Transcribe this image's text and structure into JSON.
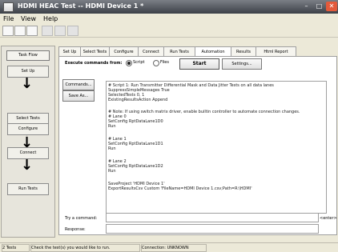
{
  "window": {
    "title": "HDMI HEAC Test -- HDMI Device 1 *",
    "minimize_glyph": "–",
    "maximize_glyph": "□",
    "close_glyph": "✕"
  },
  "menu": [
    "File",
    "View",
    "Help"
  ],
  "task_flow": {
    "title": "Task Flow",
    "steps": [
      "Set Up",
      "Select Tests",
      "Configure",
      "Connect",
      "Run Tests"
    ],
    "arrow_glyph": "↓"
  },
  "tabs": [
    "Set Up",
    "Select Tests",
    "Configure",
    "Connect",
    "Run Tests",
    "Automation",
    "Results",
    "Html Report"
  ],
  "automation": {
    "execute_label": "Execute commands from:",
    "script_option": "Script",
    "files_option": "Files",
    "start_button": "Start",
    "settings_button": "Settings...",
    "commands_button": "Commands...",
    "saveas_button": "Save As...",
    "script_lines": [
      "# Script 1: Run Transmitter Differential Mask and Data Jitter Tests on all data lanes",
      "SuppressSimpleMessages True",
      "SelectedTests 0, 1",
      "ExistingResultsAction Append",
      "",
      "# Note: If using switch matrix driver, enable builtin controller to automate connection changes.",
      "# Lane 0",
      "SetConfig RptDataLane1D0",
      "Run",
      "",
      "# Lane 1",
      "SetConfig RptDataLane1D1",
      "Run",
      "",
      "# Lane 2",
      "SetConfig RptDataLane1D2",
      "Run",
      "",
      "SaveProject 'HDMI Device 1'",
      "ExportResultsCsv Custom 'FileName=HDMI Device 1.csv;Path=R:\\HDMI'"
    ],
    "try_command_label": "Try a command:",
    "enter_hint": "<enter>",
    "response_label": "Response:"
  },
  "status_bar": {
    "tests": "2 Tests",
    "hint": "Check the test(s) you would like to run.",
    "connection": "Connection: UNKNOWN"
  }
}
